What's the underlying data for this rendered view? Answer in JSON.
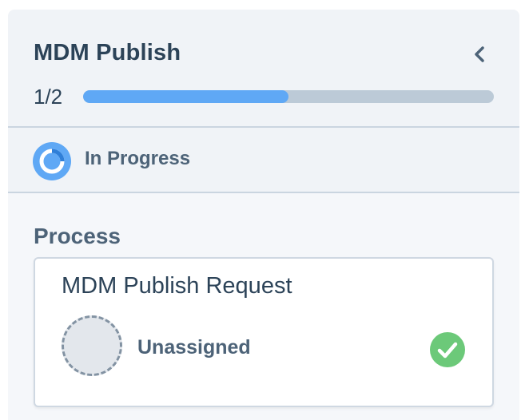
{
  "header": {
    "title": "MDM Publish",
    "progress_text": "1/2",
    "progress_fraction": 0.5
  },
  "status": {
    "label": "In Progress"
  },
  "process": {
    "section_title": "Process",
    "card": {
      "title": "MDM Publish Request",
      "assignee": "Unassigned",
      "completed": true
    }
  },
  "colors": {
    "accent": "#5fa8f5",
    "success": "#6cc979",
    "text_primary": "#2c4358",
    "text_secondary": "#4d6378"
  },
  "icons": {
    "collapse": "chevron-left-icon",
    "status": "in-progress-ring-icon",
    "complete": "check-circle-icon",
    "assignee": "unassigned-avatar"
  }
}
